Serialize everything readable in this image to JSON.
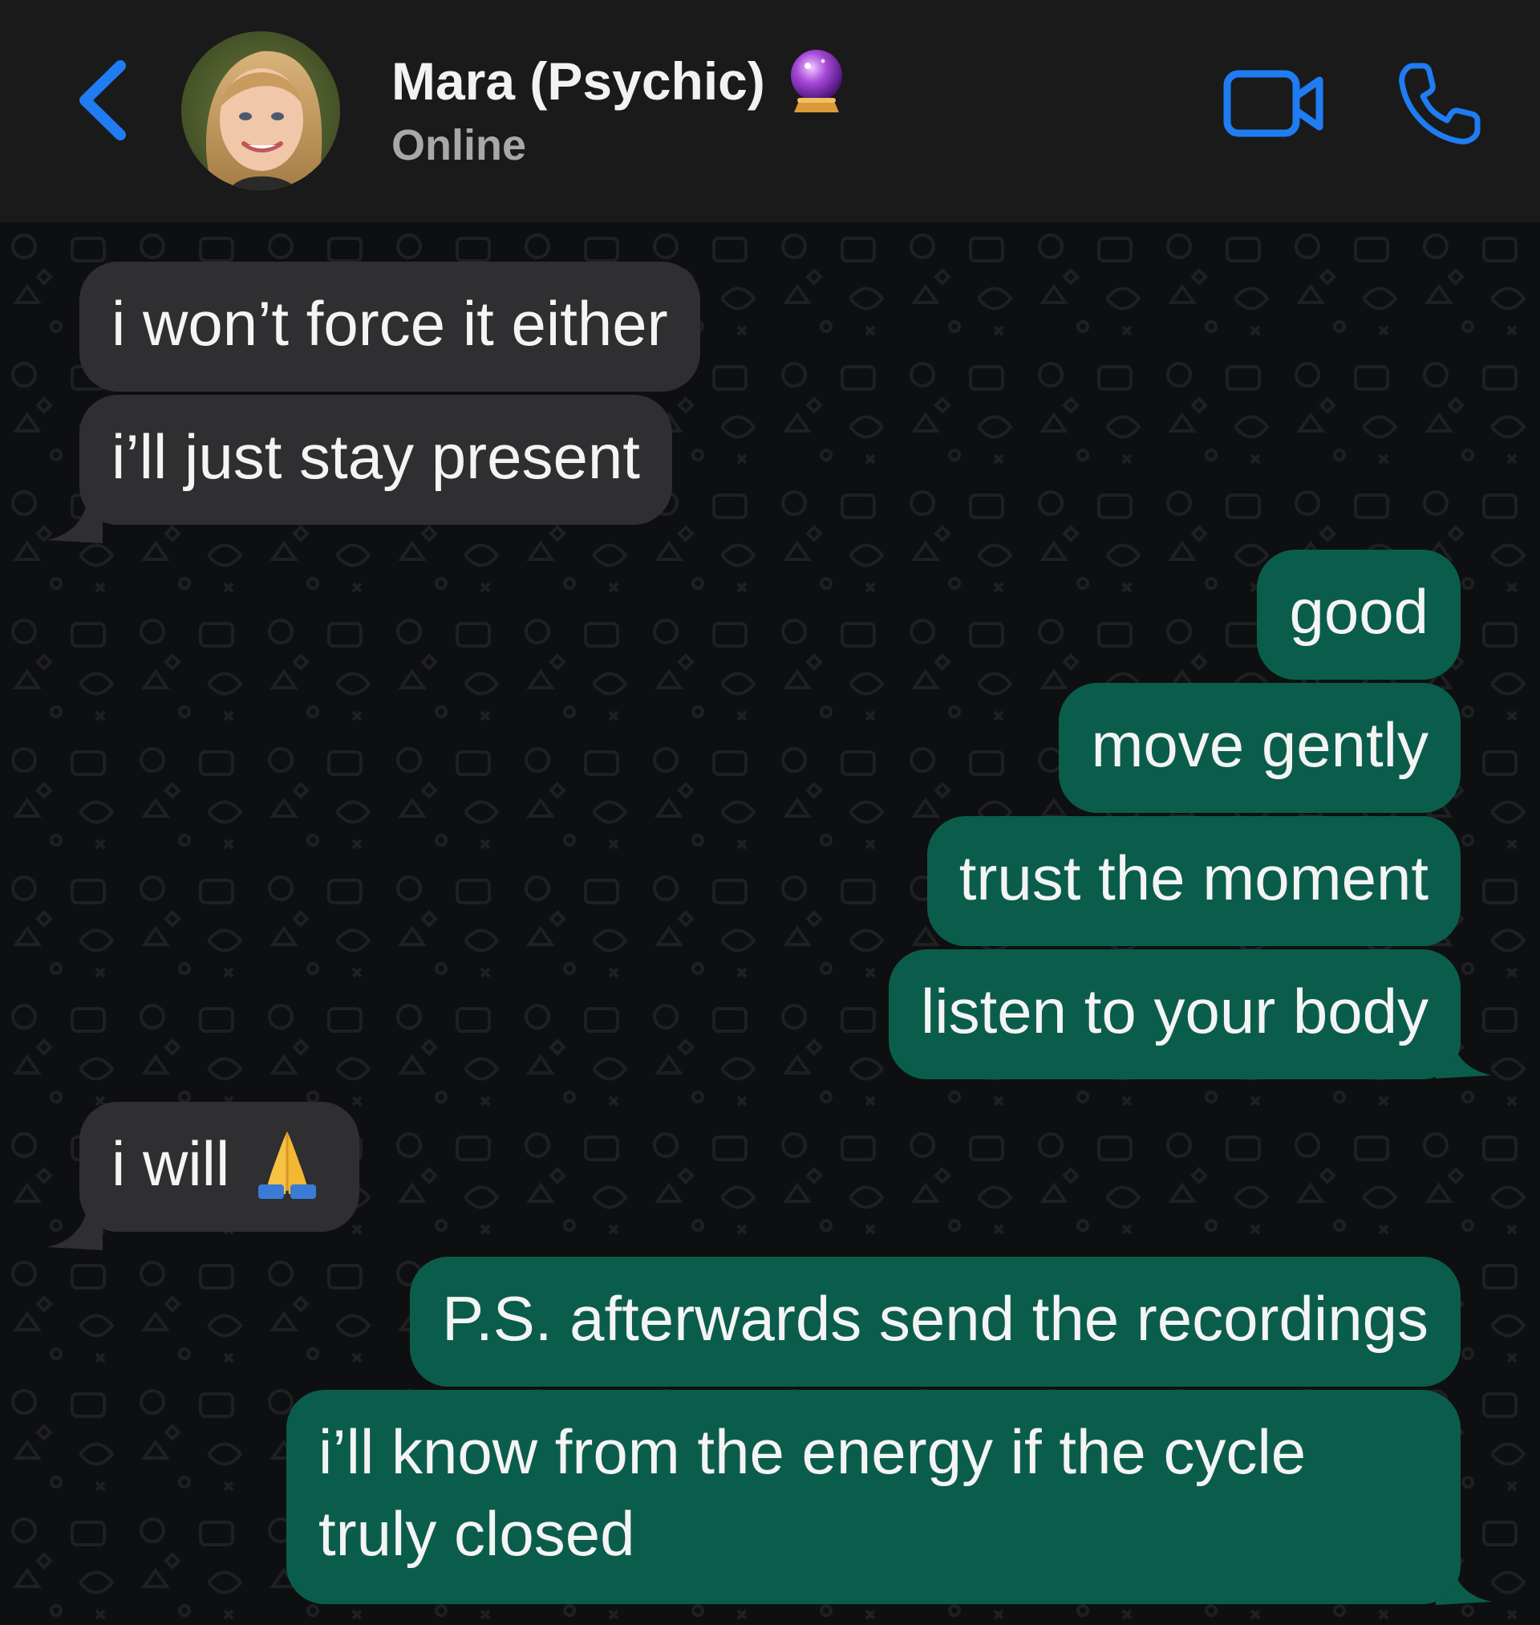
{
  "header": {
    "contact_name": "Mara (Psychic)",
    "name_emoji_icon": "crystal-ball-icon",
    "status": "Online",
    "accent_color": "#1f7cf2",
    "back_icon": "chevron-left-icon",
    "video_icon": "video-camera-icon",
    "call_icon": "phone-icon"
  },
  "colors": {
    "incoming_bubble": "#2f2f31",
    "outgoing_bubble": "#0b5d4b",
    "chat_background": "#0e0f10"
  },
  "messages": [
    {
      "direction": "incoming",
      "text": "i won’t force it either"
    },
    {
      "direction": "incoming",
      "text": "i’ll just stay present"
    },
    {
      "direction": "outgoing",
      "text": "good"
    },
    {
      "direction": "outgoing",
      "text": "move gently"
    },
    {
      "direction": "outgoing",
      "text": "trust the moment"
    },
    {
      "direction": "outgoing",
      "text": "listen to your body"
    },
    {
      "direction": "incoming",
      "text": "i will",
      "emoji_icon": "folded-hands-icon"
    },
    {
      "direction": "outgoing",
      "text": "P.S. afterwards send the recordings"
    },
    {
      "direction": "outgoing",
      "text": "i’ll know from the energy if the cycle truly closed"
    }
  ]
}
